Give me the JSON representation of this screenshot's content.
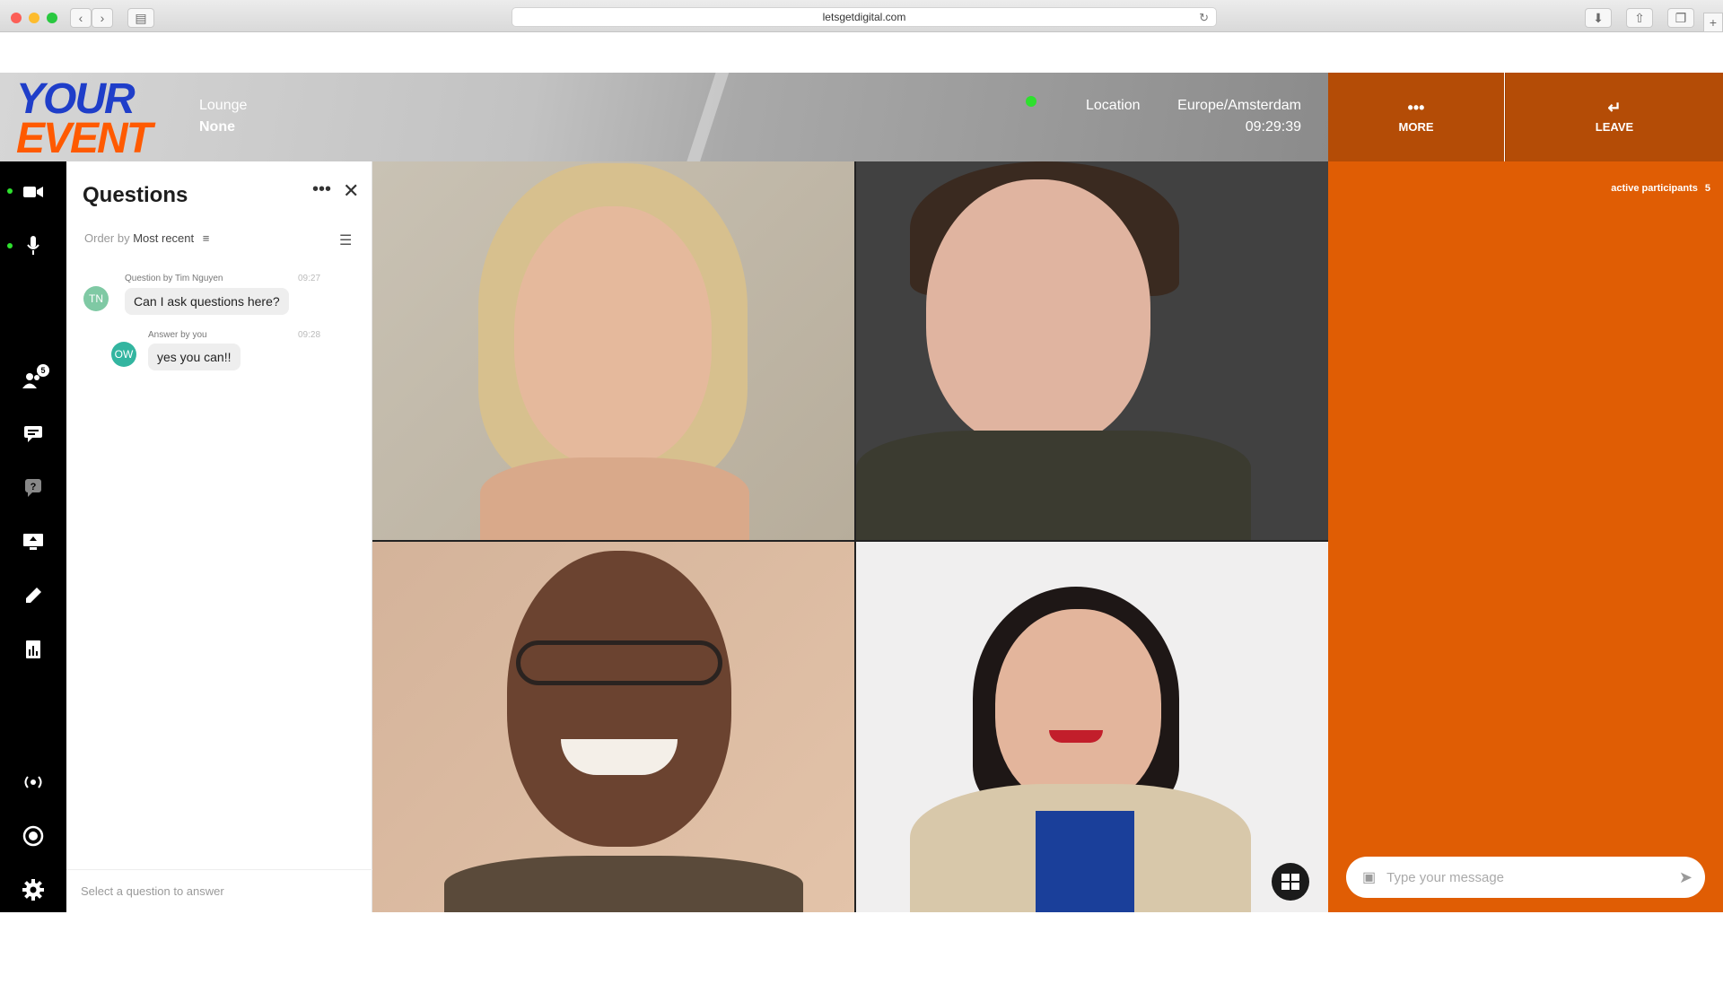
{
  "browser": {
    "url": "letsgetdigital.com"
  },
  "header": {
    "logo_line1": "YOUR",
    "logo_line2": "EVENT",
    "room_label": "Lounge",
    "room_value": "None",
    "location_label": "Location",
    "timezone": "Europe/Amsterdam",
    "clock": "09:29:39",
    "more_label": "MORE",
    "leave_label": "LEAVE",
    "status_color": "#2ee02e",
    "accent_color": "#e05d04"
  },
  "rail": {
    "items": [
      {
        "name": "camera-icon",
        "active": true
      },
      {
        "name": "microphone-icon",
        "active": true
      },
      {
        "name": "participants-icon",
        "badge": "5"
      },
      {
        "name": "chat-icon"
      },
      {
        "name": "questions-icon"
      },
      {
        "name": "screen-share-icon"
      },
      {
        "name": "whiteboard-pencil-icon"
      },
      {
        "name": "poll-report-icon"
      },
      {
        "name": "broadcast-icon"
      },
      {
        "name": "record-icon"
      },
      {
        "name": "settings-gear-icon"
      }
    ]
  },
  "questions": {
    "title": "Questions",
    "order_prefix": "Order by",
    "order_value": "Most recent",
    "footer_placeholder": "Select a question to answer",
    "items": [
      {
        "meta": "Question by Tim Nguyen",
        "time": "09:27",
        "initials": "TN",
        "avatar_color": "#7fc9a4",
        "text": "Can I ask questions here?"
      },
      {
        "meta": "Answer by you",
        "time": "09:28",
        "initials": "OW",
        "avatar_color": "#33b5a0",
        "text": "yes you can!!"
      }
    ]
  },
  "participants_panel": {
    "active_label": "active participants",
    "active_count": "5",
    "message_placeholder": "Type your message"
  }
}
